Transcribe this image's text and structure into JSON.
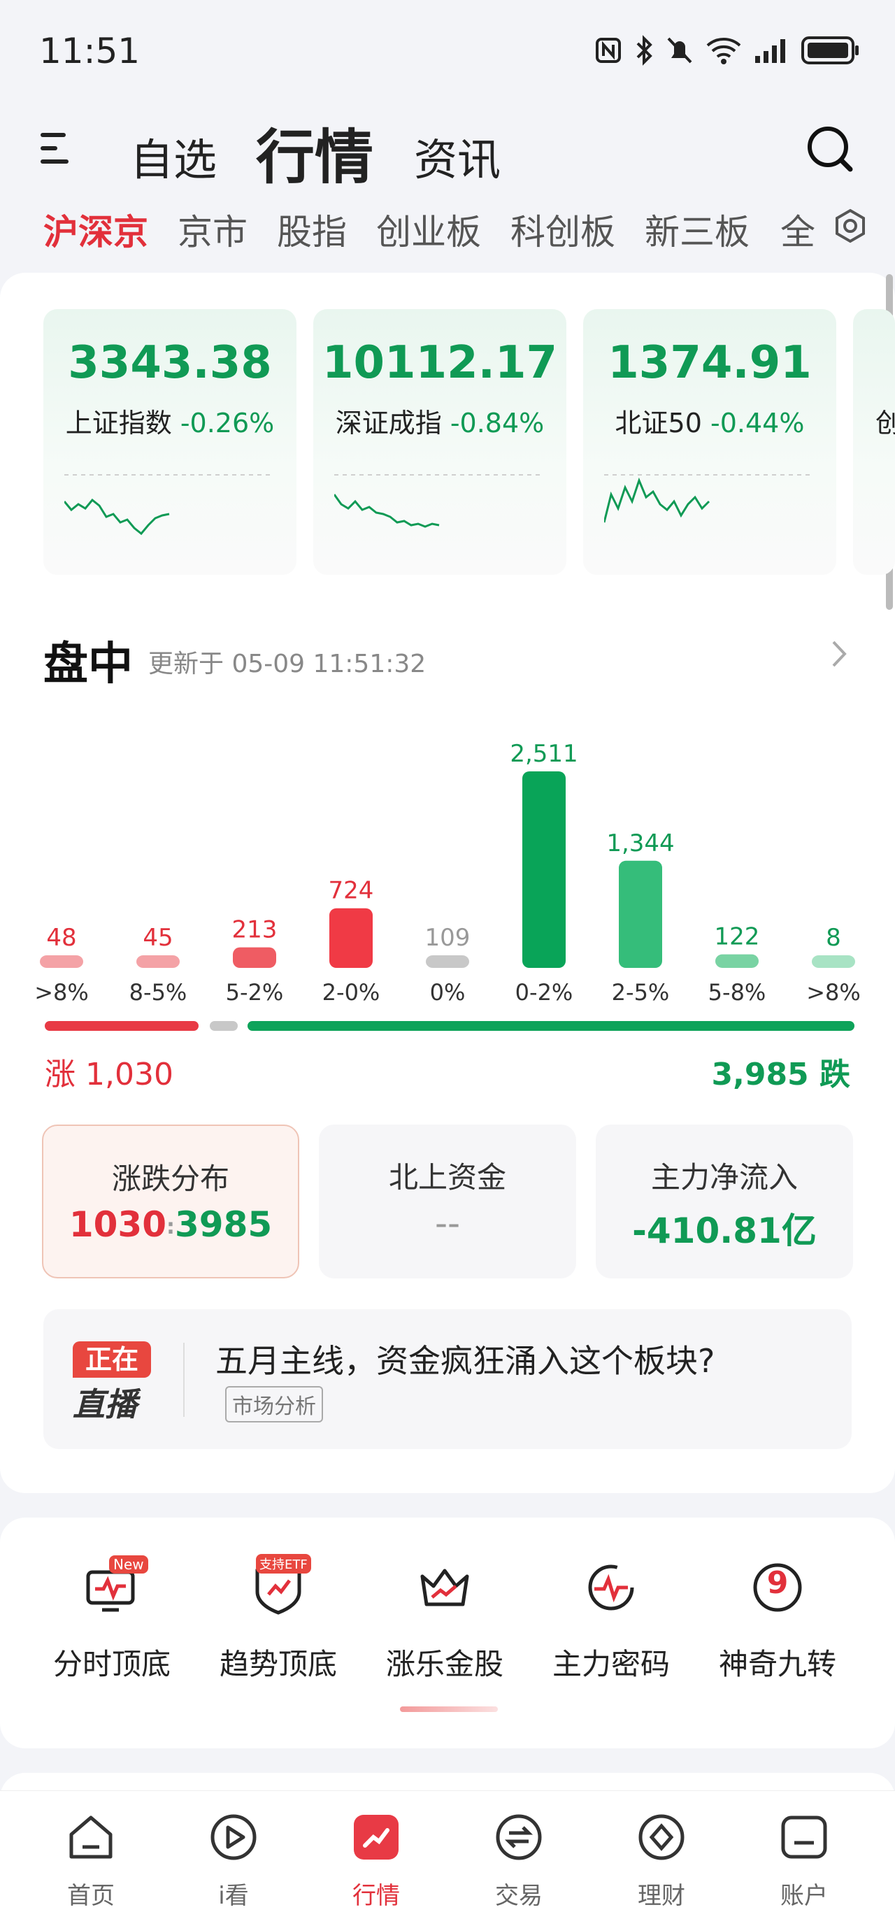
{
  "status_bar": {
    "time": "11:51"
  },
  "header": {
    "tabs": [
      {
        "label": "自选"
      },
      {
        "label": "行情"
      },
      {
        "label": "资讯"
      }
    ]
  },
  "market_tabs": [
    {
      "label": "沪深京"
    },
    {
      "label": "京市"
    },
    {
      "label": "股指"
    },
    {
      "label": "创业板"
    },
    {
      "label": "科创板"
    },
    {
      "label": "新三板"
    },
    {
      "label": "全"
    }
  ],
  "indices": [
    {
      "value": "3343.38",
      "name": "上证指数",
      "change": "-0.26%",
      "spark": [
        40,
        52,
        44,
        50,
        38,
        46,
        62,
        58,
        70,
        66,
        78,
        86,
        74,
        64,
        60,
        58
      ]
    },
    {
      "value": "10112.17",
      "name": "深证成指",
      "change": "-0.84%",
      "spark": [
        30,
        44,
        50,
        40,
        52,
        48,
        56,
        58,
        62,
        70,
        68,
        74,
        72,
        76,
        72,
        74
      ]
    },
    {
      "value": "1374.91",
      "name": "北证50",
      "change": "-0.44%",
      "spark": [
        70,
        30,
        50,
        20,
        40,
        10,
        34,
        26,
        44,
        52,
        40,
        60,
        44,
        34,
        50,
        40
      ]
    },
    {
      "value": "",
      "name": "创",
      "change": ""
    }
  ],
  "intraday": {
    "title": "盘中",
    "updated": "更新于 05-09 11:51:32"
  },
  "chart_data": {
    "type": "bar",
    "categories": [
      ">8%",
      "8-5%",
      "5-2%",
      "2-0%",
      "0%",
      "0-2%",
      "2-5%",
      "5-8%",
      ">8%"
    ],
    "values": [
      48,
      45,
      213,
      724,
      109,
      2511,
      1344,
      122,
      8
    ],
    "value_labels": [
      "48",
      "45",
      "213",
      "724",
      "109",
      "2,511",
      "1,344",
      "122",
      "8"
    ],
    "colors": [
      "#f4a2a6",
      "#f4a2a6",
      "#ef5c63",
      "#f03a45",
      "#c8c8c8",
      "#09a458",
      "#35bd7a",
      "#79d3a3",
      "#a8e3c4"
    ],
    "label_colors": [
      "#e2303b",
      "#e2303b",
      "#e2303b",
      "#e2303b",
      "#999999",
      "#109a55",
      "#109a55",
      "#109a55",
      "#109a55"
    ],
    "ylim": [
      0,
      2511
    ]
  },
  "totals": {
    "up": "涨 1,030",
    "down": "3,985 跌"
  },
  "stats": [
    {
      "label": "涨跌分布",
      "up": "1030",
      "sep": ":",
      "down": "3985"
    },
    {
      "label": "北上资金",
      "value": "--"
    },
    {
      "label": "主力净流入",
      "value": "-410.81亿"
    }
  ],
  "live": {
    "badge_top": "正在",
    "badge_bottom": "直播",
    "title": "五月主线，资金疯狂涌入这个板块?",
    "tag": "市场分析"
  },
  "tools": [
    {
      "label": "分时顶底",
      "badge": "New"
    },
    {
      "label": "趋势顶底",
      "badge": "支持ETF"
    },
    {
      "label": "涨乐金股"
    },
    {
      "label": "主力密码"
    },
    {
      "label": "神奇九转",
      "glyph": "9"
    }
  ],
  "bottom_nav": [
    {
      "label": "首页"
    },
    {
      "label": "i看"
    },
    {
      "label": "行情"
    },
    {
      "label": "交易"
    },
    {
      "label": "理财"
    },
    {
      "label": "账户"
    }
  ],
  "colors": {
    "up": "#e2303b",
    "down": "#109a55",
    "accent": "#e2303b"
  }
}
